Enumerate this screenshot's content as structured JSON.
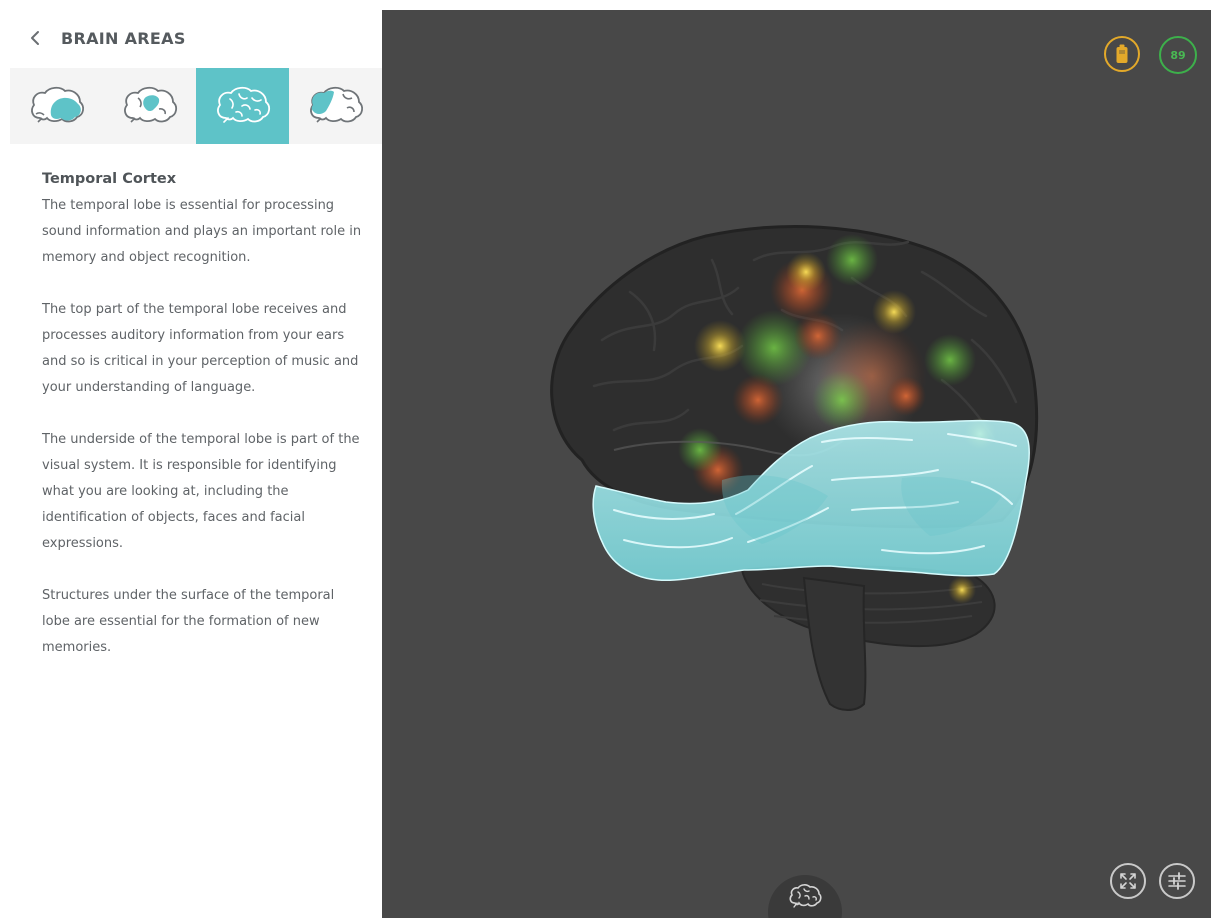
{
  "header": {
    "back_icon": "chevron-left-icon",
    "title": "BRAIN AREAS"
  },
  "tabs": [
    {
      "icon": "brain-temporal-region-icon",
      "active": false
    },
    {
      "icon": "brain-parietal-region-icon",
      "active": false
    },
    {
      "icon": "brain-outline-icon",
      "active": true
    },
    {
      "icon": "brain-frontal-region-icon",
      "active": false
    }
  ],
  "area": {
    "title": "Temporal Cortex",
    "paragraphs": [
      "The temporal lobe is essential for processing sound information and plays an important role in memory and object recognition.",
      "The top part of the temporal lobe receives and processes auditory information from your ears and so is critical in your perception of music and your understanding of language.",
      "The underside of the temporal lobe is part of the visual system. It is responsible for identifying what you are looking at, including the identification of objects, faces and facial expressions.",
      "Structures under the surface of the temporal lobe are essential for the formation of new memories."
    ]
  },
  "viewer": {
    "battery_icon": "battery-icon",
    "signal_score": "89",
    "expand_icon": "expand-icon",
    "settings_icon": "sliders-icon",
    "brain_mode_icon": "brain-icon"
  },
  "colors": {
    "accent": "#5ec3c8",
    "highlight_region": "#8fe6ea",
    "viewer_bg": "#484848",
    "battery": "#e3a92a",
    "score": "#3db04b"
  }
}
